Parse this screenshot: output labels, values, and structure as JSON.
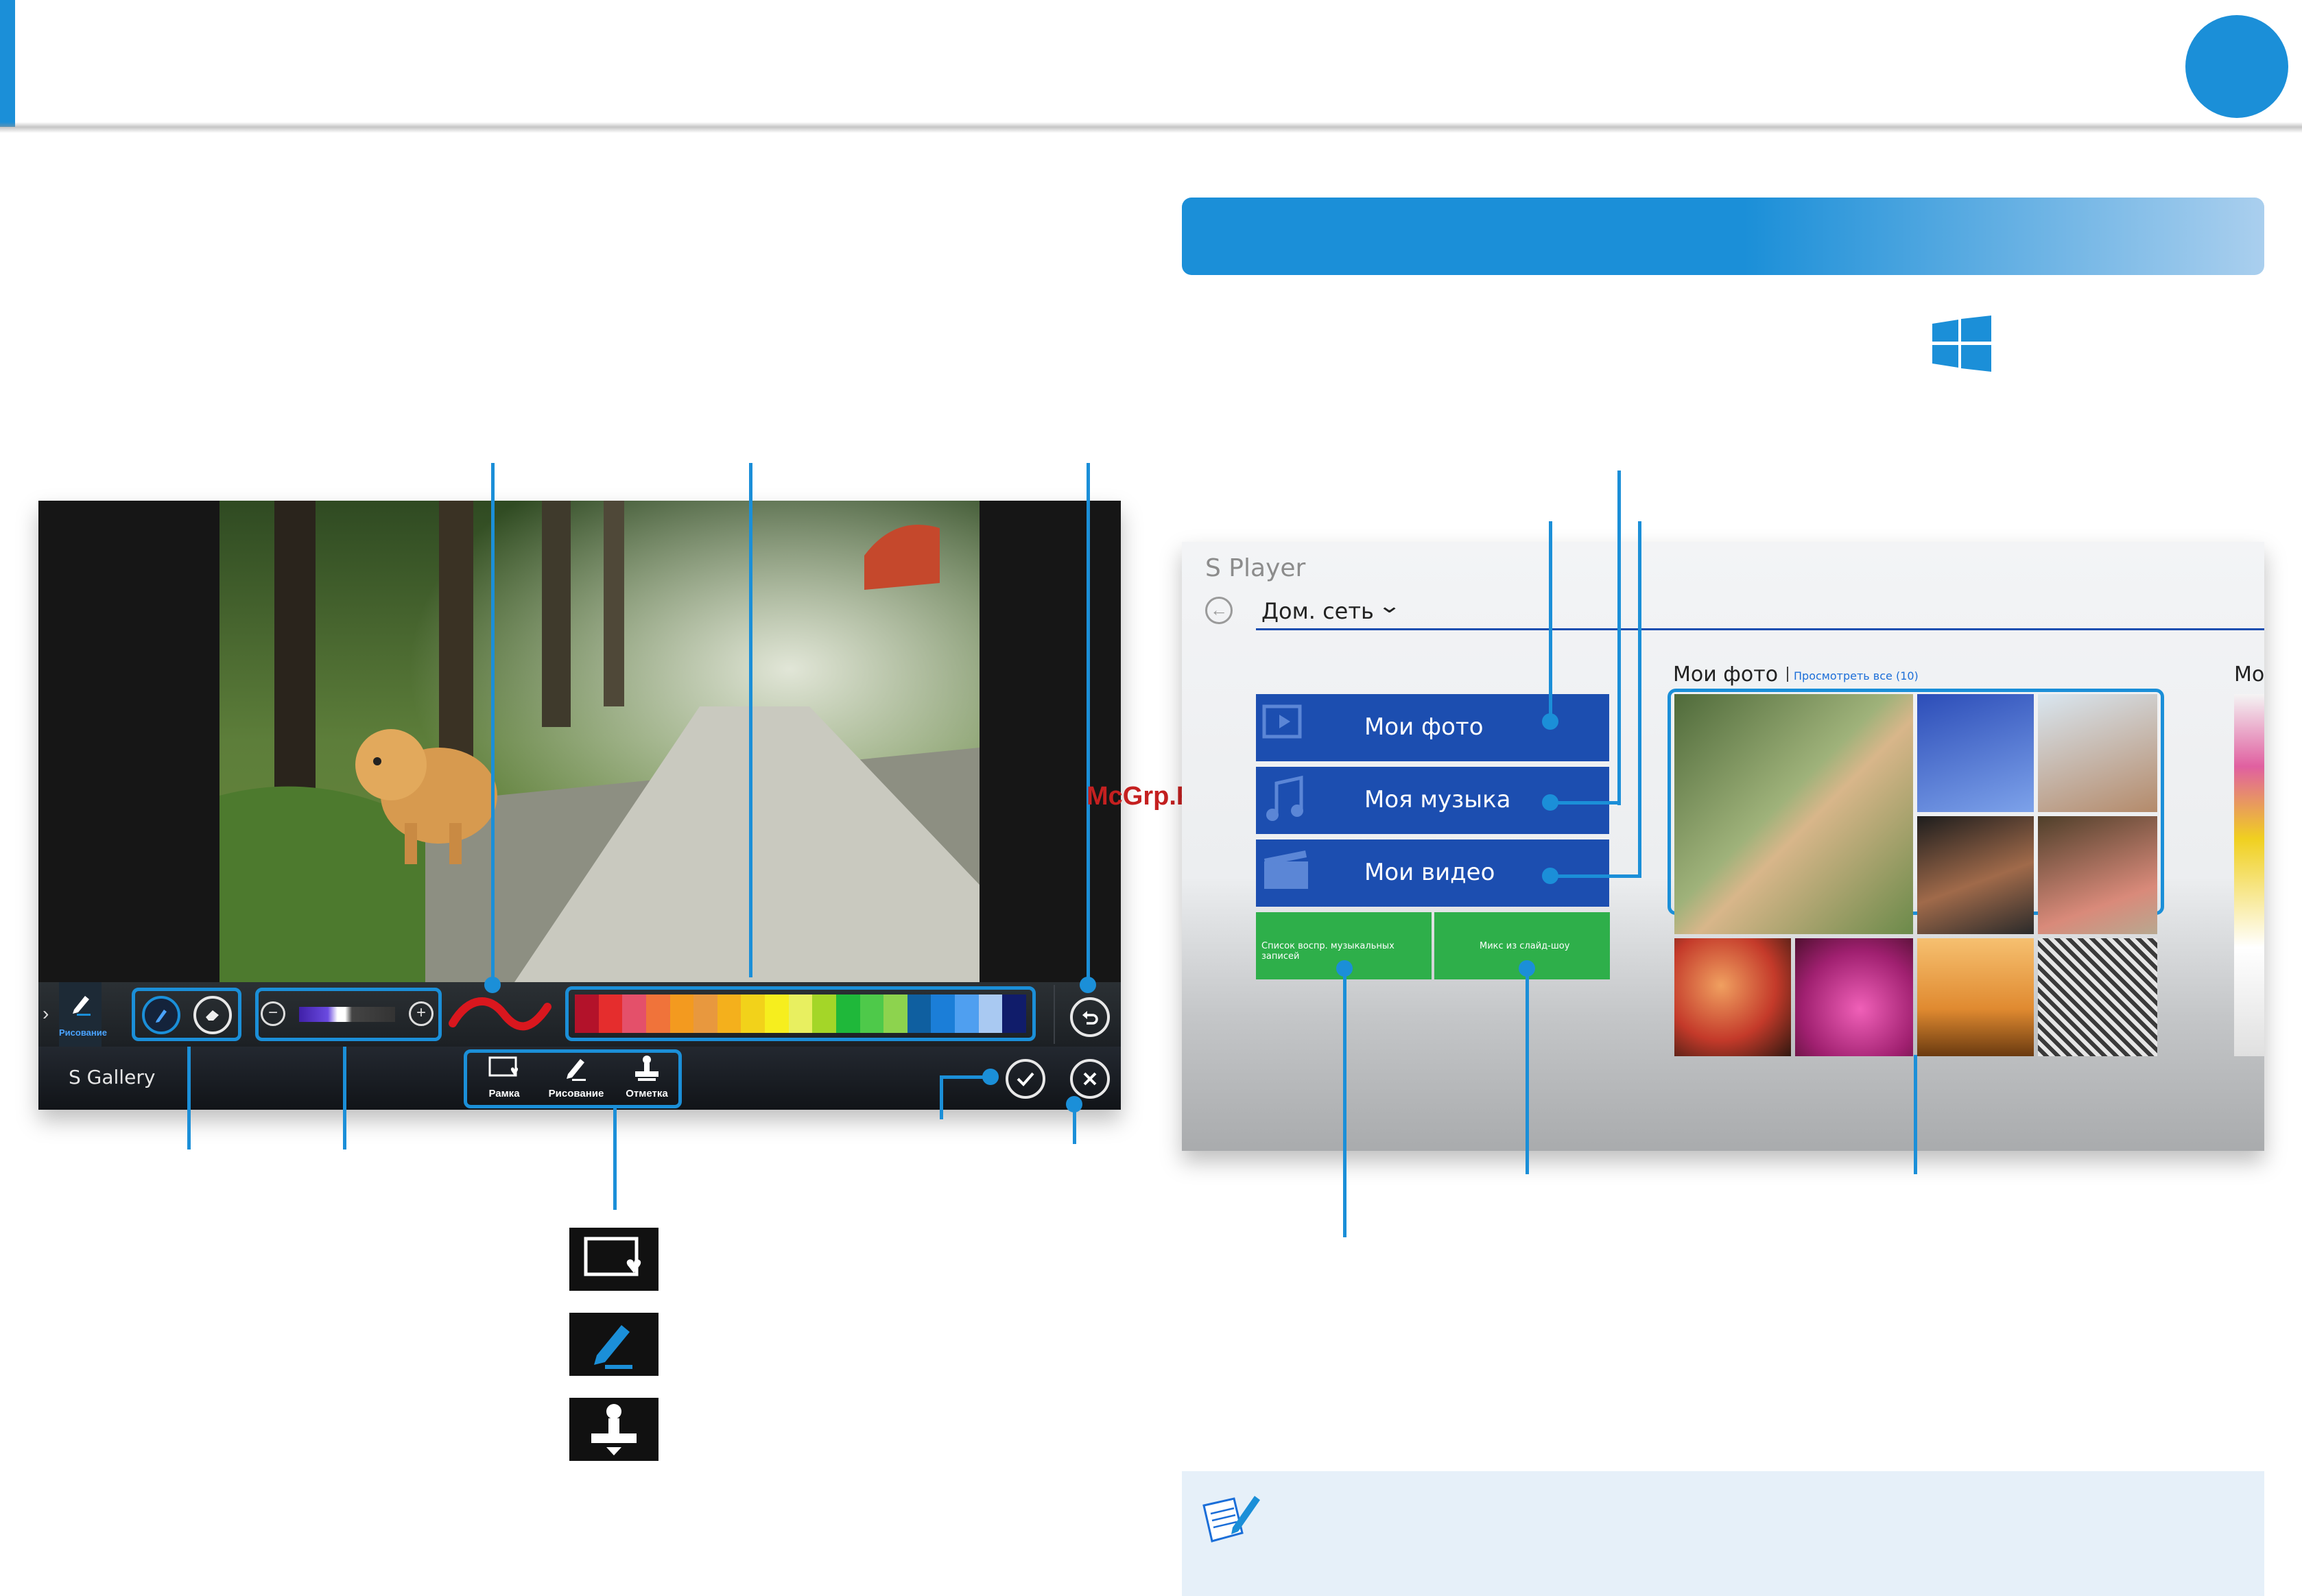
{
  "colors": {
    "accent": "#1b8fd8",
    "tile_blue": "#1c4eb0",
    "tile_green": "#2eaf4a",
    "note_bg": "#e6f0f9"
  },
  "watermark": "McGrp.Ru",
  "gallery": {
    "app_name": "S Gallery",
    "mode_label": "Рисование",
    "tools": [
      "pen-icon",
      "eraser-icon"
    ],
    "brush_size": {
      "minus": "⊖",
      "plus": "⊕"
    },
    "palette": [
      "#b3122a",
      "#e52d2d",
      "#e4506a",
      "#f0733a",
      "#f39a1f",
      "#e8983e",
      "#f4b01c",
      "#f2d21a",
      "#f6ee1e",
      "#e8ef60",
      "#a4d628",
      "#1fb83a",
      "#4ec94a",
      "#8dd34e",
      "#0f5fa0",
      "#1b7ed8",
      "#4f9ff0",
      "#a9c9f2",
      "#101c6a"
    ],
    "bottom_tools": [
      {
        "label": "Рамка",
        "icon": "frame-icon"
      },
      {
        "label": "Рисование",
        "icon": "draw-icon"
      },
      {
        "label": "Отметка",
        "icon": "stamp-icon"
      }
    ]
  },
  "legend_icons": [
    "frame-icon",
    "draw-icon",
    "stamp-icon"
  ],
  "splayer": {
    "title": "S Player",
    "location": "Дом. сеть",
    "tiles": [
      "Мои фото",
      "Моя музыка",
      "Мои видео"
    ],
    "green_tiles": [
      "Список воспр. музыкальных записей",
      "Микс из слайд-шоу"
    ],
    "photos_heading": "Мои фото",
    "see_all": "Просмотреть все (10)",
    "next_heading": "Мо"
  }
}
